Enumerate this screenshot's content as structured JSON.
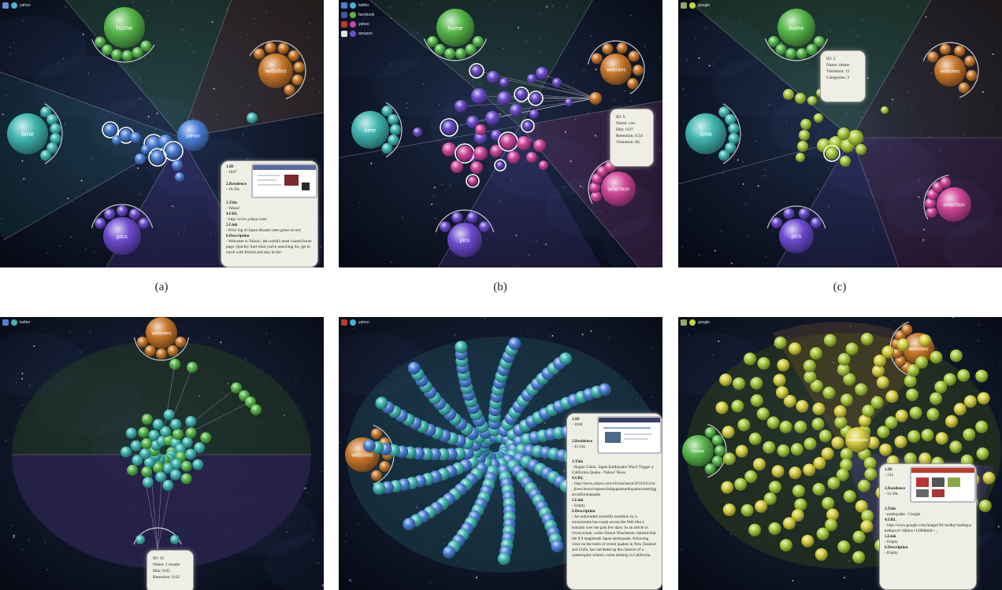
{
  "captions": [
    "(a)",
    "(b)",
    "(c)"
  ],
  "panel_a": {
    "menu": [
      "yahoo"
    ],
    "cluster_labels": {
      "home": "home",
      "websites": "websites",
      "time": "time",
      "pics": "pics",
      "yahoo": "yahoo"
    },
    "card": {
      "id_label": "1.ID",
      "id_value": "- 1047",
      "res_label": "2.Residence",
      "res_value": "- 19.59s",
      "title_label": "3.Title",
      "title_value": "- Yahoo!",
      "url_label": "4.URL",
      "url_value": "- http://www.yahoo.com/",
      "link_label": "5.Link",
      "link_value": "- Prior log of Japan disaster seen gross record",
      "desc_label": "6.Description",
      "desc_value": "- Welcome to Yahoo!, the world's most visited home page. Quickly find what you're searching for, get in touch with friends and stay in-the-"
    }
  },
  "panel_b": {
    "menu": [
      "twitter",
      "facebook",
      "yahoo",
      "amazon"
    ],
    "cluster_labels": {
      "home": "home",
      "websites": "websites",
      "time": "time",
      "pics": "pics",
      "selection": "selection"
    },
    "tooltip": [
      "ID: 6",
      "Name: con",
      "Hits: 0.07",
      "Retention: 0.54",
      "Visitation: 84"
    ]
  },
  "panel_c": {
    "menu": [
      "google"
    ],
    "cluster_labels": {
      "home": "home",
      "websites": "websites",
      "time": "time",
      "pics": "pics",
      "selection": "selection"
    },
    "tooltip": [
      "ID: 2",
      "Name: theme",
      "Visitation: 15",
      "Categories: 3"
    ]
  },
  "panel_d": {
    "menu": [
      "twitter"
    ],
    "cluster_labels": {
      "websites": "websites"
    },
    "tooltip": [
      "ID: 25",
      "Name: 1 results",
      "Hits: 0.05",
      "Retention: 0.03"
    ]
  },
  "panel_e": {
    "menu": [
      "yahoo"
    ],
    "cluster_labels": {
      "websites": "websites"
    },
    "card": {
      "id_label": "1.ID",
      "id_value": "- 1046",
      "res_label": "2.Residence",
      "res_value": "- 41.54s",
      "title_label": "3.Title",
      "title_value": "- Rogue Claim: Japan Earthquake Won't Trigger a California Quake - Yahoo! News",
      "url_label": "4.URL",
      "url_value": "- http://news.yahoo.com/s/livescience/20110312/sc_livescience/roguenclaimjapanearthquakewonttriggercaliforniaquake",
      "link_label": "5.Link",
      "link_value": "- Empty",
      "desc_label": "6.Description",
      "desc_value": "- An unfounded scientific assertion by a nonscientist has swept across the Web like a tsunami over the past few days. In an article in Overcoonek, writer Simon Winchester claimed that the 8.9 magnitude Japan earthquake, following close on the heels of recent quakes in New Zealand and Chile, has ratcheted up the chances of a catastrophic seismic event striking in California."
    }
  },
  "panel_f": {
    "menu": [
      "google"
    ],
    "cluster_labels": {
      "websites": "websites",
      "home": "home",
      "earthquake": "earthquake"
    },
    "card": {
      "id_label": "1.ID",
      "id_value": "- 142",
      "res_label": "2.Residence",
      "res_value": "- 33.38s",
      "title_label": "3.Title",
      "title_value": "- earthquake - Google",
      "url_label": "4.URL",
      "url_value": "- http://www.google.com/images?hl=ko&q=earthquake&qscrl=1&biw=1280&bih=...",
      "link_label": "5.Link",
      "link_value": "- Empty",
      "desc_label": "6.Description",
      "desc_value": "- Empty"
    }
  },
  "colors": {
    "green": "#57b84a",
    "orange": "#c9782a",
    "cyan": "#3fb6b0",
    "purple": "#6d4bd0",
    "blue": "#4a80d8",
    "magenta": "#d0469a",
    "lime": "#a9c93a",
    "yellow": "#d6cf3e"
  }
}
